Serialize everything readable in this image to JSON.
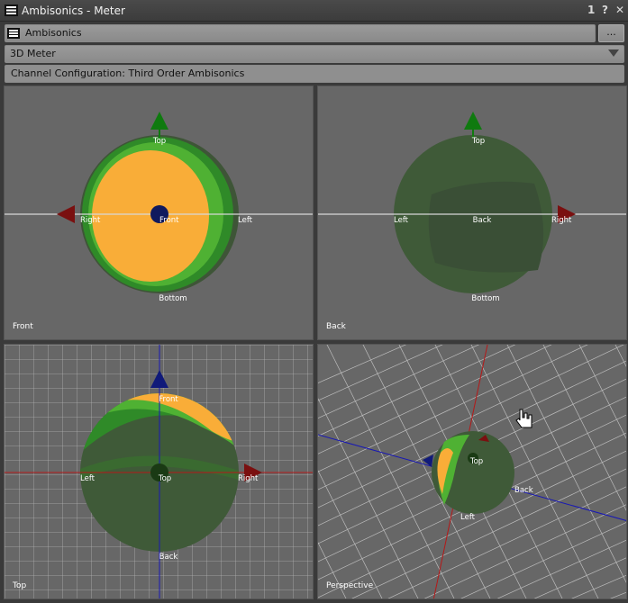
{
  "window": {
    "title": "Ambisonics - Meter",
    "controls": [
      "1",
      "?",
      "✕"
    ]
  },
  "plugin": {
    "name": "Ambisonics",
    "more_label": "..."
  },
  "mode": {
    "selected": "3D Meter"
  },
  "config": {
    "text": "Channel Configuration: Third Order Ambisonics"
  },
  "views": {
    "front": {
      "name": "Front",
      "labels": {
        "top": "Top",
        "bottom": "Bottom",
        "left": "Left",
        "right": "Right",
        "center": "Front"
      }
    },
    "back": {
      "name": "Back",
      "labels": {
        "top": "Top",
        "bottom": "Bottom",
        "left": "Left",
        "right": "Right",
        "center": "Back"
      }
    },
    "top": {
      "name": "Top",
      "labels": {
        "front": "Front",
        "back": "Back",
        "left": "Left",
        "right": "Right",
        "center": "Top"
      }
    },
    "perspective": {
      "name": "Perspective",
      "labels": {
        "top": "Top",
        "back": "Back",
        "left": "Left"
      }
    }
  },
  "colors": {
    "hot": "#f9ad38",
    "green_light": "#4fb133",
    "green_mid": "#2f7f27",
    "green_dark": "#3f5a38",
    "up_axis": "#0f7a0f",
    "side_axis": "#7a1010",
    "front_axis": "#101a7a"
  }
}
